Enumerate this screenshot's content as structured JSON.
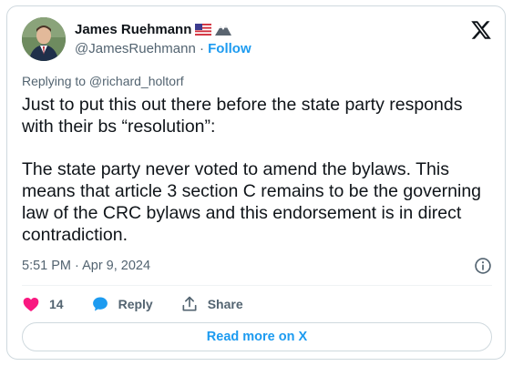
{
  "author": {
    "display_name": "James Ruehmann",
    "handle": "@JamesRuehmann",
    "separator": "·",
    "follow_label": "Follow",
    "flag_icon": "us-flag-emoji",
    "badge_icon": "mountain-emoji"
  },
  "tweet": {
    "replying_to": "Replying to @richard_holtorf",
    "text": "Just to put this out there before the state party responds with their bs “resolution”:\n\nThe state party never voted to amend the bylaws. This means that article 3 section C remains to be the governing law of the CRC bylaws and this endorsement is in direct contradiction.",
    "timestamp": "5:51 PM · Apr 9, 2024"
  },
  "actions": {
    "like_count": "14",
    "reply_label": "Reply",
    "share_label": "Share"
  },
  "read_more_label": "Read more on X",
  "colors": {
    "accent": "#1d9bf0",
    "like": "#f91880",
    "text": "#0f1419",
    "secondary": "#536471",
    "border": "#cfd9de"
  }
}
